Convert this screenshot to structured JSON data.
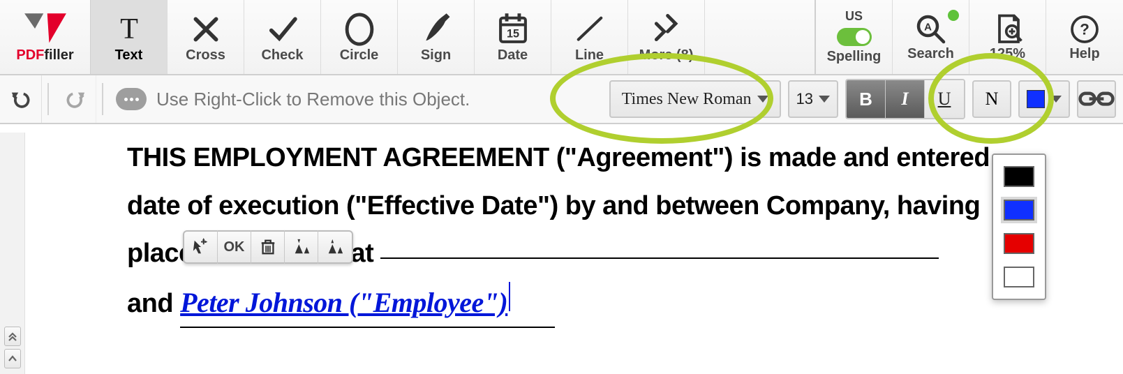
{
  "logo": {
    "brand_prefix": "PDF",
    "brand_suffix": "filler"
  },
  "toolbar": {
    "text": "Text",
    "cross": "Cross",
    "check": "Check",
    "circle": "Circle",
    "sign": "Sign",
    "date": "Date",
    "line": "Line",
    "more": "More (8)"
  },
  "right_toolbar": {
    "spelling_label": "Spelling",
    "spelling_region": "US",
    "search": "Search",
    "zoom": "125%",
    "help": "Help"
  },
  "subtoolbar": {
    "hint": "Use Right-Click to Remove this Object.",
    "font": "Times New Roman",
    "font_size": "13",
    "bold": "B",
    "italic": "I",
    "underline": "U",
    "normal": "N",
    "color_current": "#1030ff"
  },
  "object_toolbar": {
    "ok": "OK"
  },
  "color_options": [
    {
      "name": "black",
      "hex": "#000000"
    },
    {
      "name": "blue",
      "hex": "#1030ff",
      "selected": true
    },
    {
      "name": "red",
      "hex": "#e50000"
    },
    {
      "name": "white",
      "hex": "#ffffff"
    }
  ],
  "document": {
    "line1": "THIS EMPLOYMENT AGREEMENT (\"Agreement\") is made and entered",
    "line2": "date of execution (\"Effective Date\") by and between Company, having",
    "line3_prefix": "place of business at ",
    "line4_prefix": "and  ",
    "employee_text": "Peter Johnson (\"Employee\")"
  }
}
